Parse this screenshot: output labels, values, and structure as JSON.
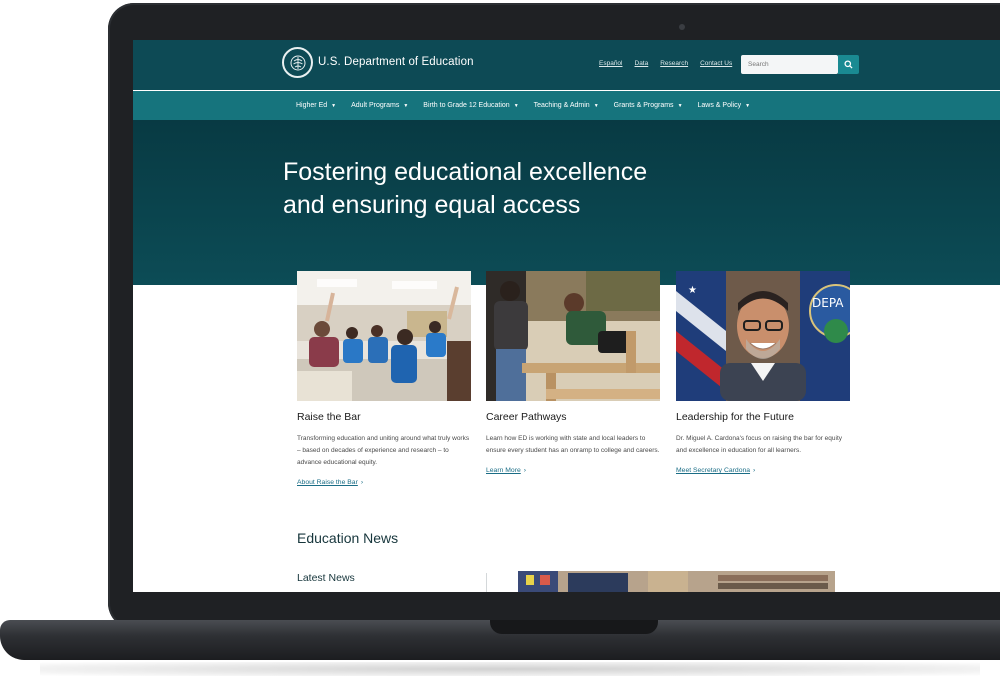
{
  "header": {
    "brand": "U.S. Department of Education",
    "utility_links": [
      "Español",
      "Data",
      "Research",
      "Contact Us"
    ],
    "search": {
      "placeholder": "Search"
    }
  },
  "nav": {
    "items": [
      "Higher Ed",
      "Adult Programs",
      "Birth to Grade 12 Education",
      "Teaching & Admin",
      "Grants & Programs",
      "Laws & Policy"
    ]
  },
  "hero": {
    "title": "Fostering educational excellence and ensuring equal access"
  },
  "cards": [
    {
      "title": "Raise the Bar",
      "text": "Transforming education and uniting around what truly works – based on decades of experience and research – to advance educational equity.",
      "link": "About Raise the Bar"
    },
    {
      "title": "Career Pathways",
      "text": "Learn how ED is working with state and local leaders to ensure every student has an onramp to college and careers.",
      "link": "Learn More"
    },
    {
      "title": "Leadership for the Future",
      "text": "Dr. Miguel A. Cardona's focus on raising the bar for equity and excellence in education for all learners.",
      "link": "Meet Secretary Cardona"
    }
  ],
  "news": {
    "heading": "Education News",
    "latest": "Latest News"
  },
  "photo_texts": {
    "seal_text": "DEPA"
  },
  "colors": {
    "header_bg": "#0d4a55",
    "nav_bg": "#16747d",
    "hero_bg": "#083a43",
    "link": "#1a6d86",
    "search_button": "#1a8a92"
  },
  "icons": [
    "seal-logo-icon",
    "search-icon",
    "chevron-down-icon",
    "chevron-right-icon"
  ]
}
